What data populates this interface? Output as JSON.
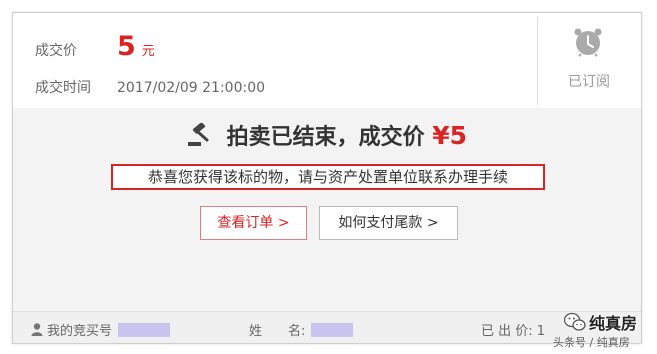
{
  "header": {
    "price_label": "成交价",
    "price_value": "5",
    "price_unit": "元",
    "time_label": "成交时间",
    "time_value": "2017/02/09 21:00:00",
    "subscribed_label": "已订阅",
    "icon": "alarm-clock-icon"
  },
  "status": {
    "ended_text": "拍卖已结束，成交价",
    "final_price": "¥5",
    "gavel_icon": "gavel-icon",
    "congrats_text": "恭喜您获得该标的物，请与资产处置单位联系办理手续"
  },
  "buttons": {
    "view_order": "查看订单 >",
    "how_to_pay": "如何支付尾款 >"
  },
  "footer": {
    "bid_no_label": "我的竞买号",
    "surname_label": "姓　　名:",
    "bid_count_label": "已 出 价: 1",
    "user_icon": "user-icon"
  },
  "watermark": {
    "title": "纯真房",
    "subtitle": "头条号 / 纯真房"
  },
  "colors": {
    "accent": "#d92424",
    "background": "#f3f3f3",
    "mask": "#c8c4ee"
  }
}
